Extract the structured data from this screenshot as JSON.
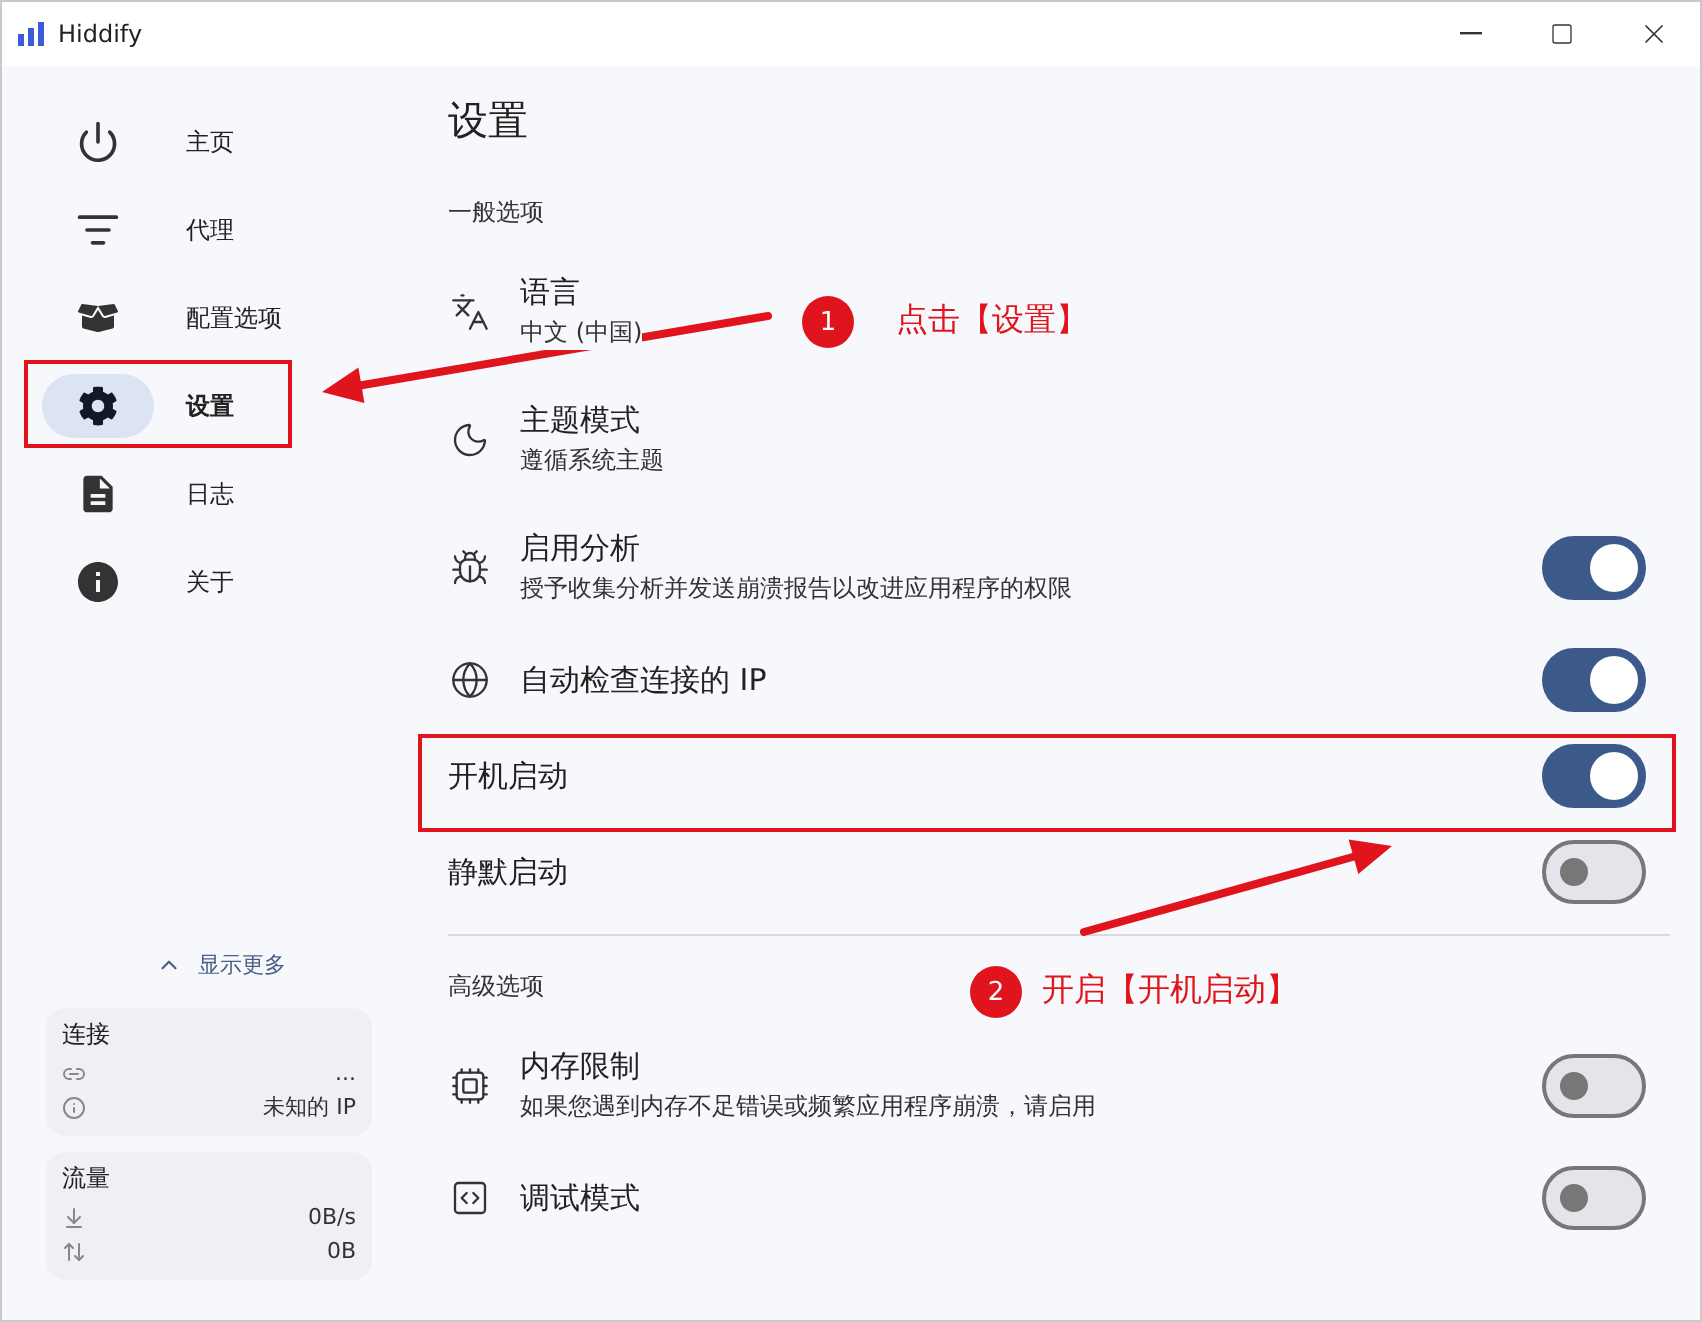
{
  "window": {
    "title": "Hiddify"
  },
  "sidebar": {
    "items": [
      {
        "label": "主页",
        "selected": false
      },
      {
        "label": "代理",
        "selected": false
      },
      {
        "label": "配置选项",
        "selected": false
      },
      {
        "label": "设置",
        "selected": true
      },
      {
        "label": "日志",
        "selected": false
      },
      {
        "label": "关于",
        "selected": false
      }
    ],
    "show_more": "显示更多",
    "cards": [
      {
        "title": "连接",
        "rows": [
          {
            "value": "..."
          },
          {
            "value": "未知的 IP"
          }
        ]
      },
      {
        "title": "流量",
        "rows": [
          {
            "value": "0B/s"
          },
          {
            "value": "0B"
          }
        ]
      }
    ]
  },
  "page": {
    "title": "设置",
    "sections": [
      {
        "title": "一般选项",
        "items": [
          {
            "kind": "link",
            "label": "语言",
            "subtitle": "中文 (中国)"
          },
          {
            "kind": "link",
            "label": "主题模式",
            "subtitle": "遵循系统主题"
          },
          {
            "kind": "switch",
            "label": "启用分析",
            "subtitle": "授予收集分析并发送崩溃报告以改进应用程序的权限",
            "on": true
          },
          {
            "kind": "switch",
            "label": "自动检查连接的 IP",
            "on": true
          },
          {
            "kind": "switch",
            "label": "开机启动",
            "on": true
          },
          {
            "kind": "switch",
            "label": "静默启动",
            "on": false
          }
        ]
      },
      {
        "title": "高级选项",
        "items": [
          {
            "kind": "switch",
            "label": "内存限制",
            "subtitle": "如果您遇到内存不足错误或频繁应用程序崩溃，请启用",
            "on": false
          },
          {
            "kind": "switch",
            "label": "调试模式",
            "on": false
          }
        ]
      }
    ]
  },
  "annotations": [
    {
      "number": "1",
      "text": "点击【设置】"
    },
    {
      "number": "2",
      "text": "开启【开机启动】"
    }
  ]
}
